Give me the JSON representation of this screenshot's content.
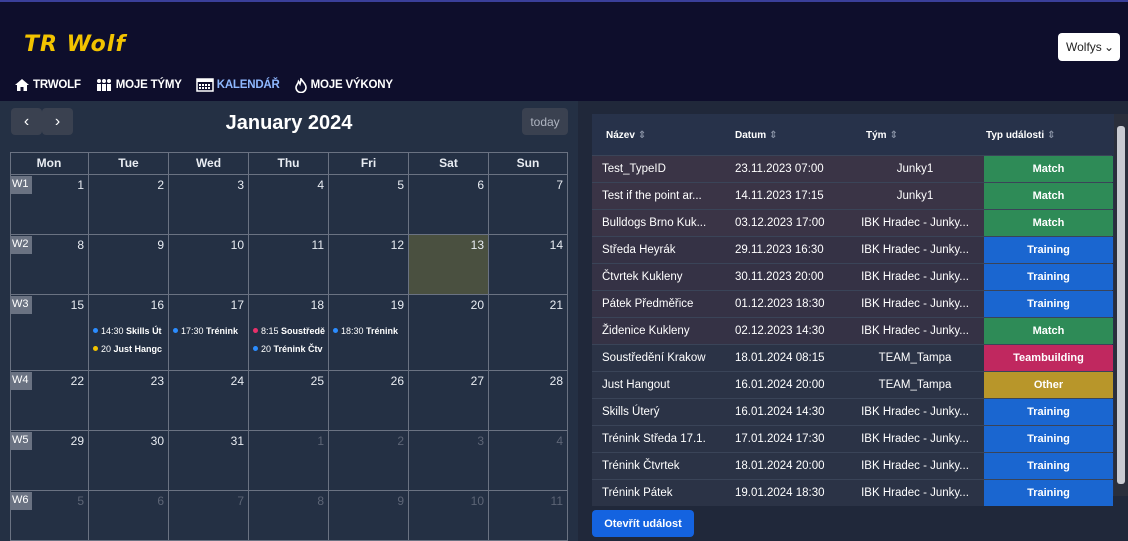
{
  "app": {
    "brand": "TR Wolf",
    "user": "Wolfys"
  },
  "nav": [
    {
      "label": "TRWOLF",
      "icon": "home-icon"
    },
    {
      "label": "MOJE TÝMY",
      "icon": "team-icon"
    },
    {
      "label": "KALENDÁŘ",
      "icon": "calendar-icon",
      "active": true
    },
    {
      "label": "MOJE VÝKONY",
      "icon": "fire-icon"
    }
  ],
  "calendar": {
    "title": "January 2024",
    "today_label": "today",
    "prev_label": "‹",
    "next_label": "›",
    "weekdays": [
      "Mon",
      "Tue",
      "Wed",
      "Thu",
      "Fri",
      "Sat",
      "Sun"
    ],
    "weeks": [
      {
        "label": "W1",
        "days": [
          "1",
          "2",
          "3",
          "4",
          "5",
          "6",
          "7"
        ]
      },
      {
        "label": "W2",
        "days": [
          "8",
          "9",
          "10",
          "11",
          "12",
          "13",
          "14"
        ]
      },
      {
        "label": "W3",
        "days": [
          "15",
          "16",
          "17",
          "18",
          "19",
          "20",
          "21"
        ]
      },
      {
        "label": "W4",
        "days": [
          "22",
          "23",
          "24",
          "25",
          "26",
          "27",
          "28"
        ]
      },
      {
        "label": "W5",
        "days": [
          "29",
          "30",
          "31",
          "1",
          "2",
          "3",
          "4"
        ]
      },
      {
        "label": "W6",
        "days": [
          "5",
          "6",
          "7",
          "8",
          "9",
          "10",
          "11"
        ]
      }
    ],
    "events": [
      {
        "time": "14:30",
        "title": "Skills Út",
        "color": "#2b8cff"
      },
      {
        "time": "20",
        "title": "Just Hangc",
        "color": "#f2c300"
      },
      {
        "time": "17:30",
        "title": "Trénink",
        "color": "#2b8cff"
      },
      {
        "time": "8:15",
        "title": "Soustředě",
        "color": "#e8306a"
      },
      {
        "time": "20",
        "title": "Trénink Čtv",
        "color": "#2b8cff"
      },
      {
        "time": "18:30",
        "title": "Trénink",
        "color": "#2b8cff"
      }
    ]
  },
  "events_table": {
    "headers": [
      "Název",
      "Datum",
      "Tým",
      "Typ události"
    ],
    "sort_glyph": "⇕",
    "rows": [
      {
        "name": "Test_TypeID",
        "date": "23.11.2023 07:00",
        "team": "Junky1",
        "type": "Match",
        "color": "#2e8b57"
      },
      {
        "name": "Test if the point ar...",
        "date": "14.11.2023 17:15",
        "team": "Junky1",
        "type": "Match",
        "color": "#2e8b57"
      },
      {
        "name": "Bulldogs Brno Kuk...",
        "date": "03.12.2023 17:00",
        "team": "IBK Hradec - Junky...",
        "type": "Match",
        "color": "#2e8b57"
      },
      {
        "name": "Středa Heyrák",
        "date": "29.11.2023 16:30",
        "team": "IBK Hradec - Junky...",
        "type": "Training",
        "color": "#1a66d0"
      },
      {
        "name": "Čtvrtek Kukleny",
        "date": "30.11.2023 20:00",
        "team": "IBK Hradec - Junky...",
        "type": "Training",
        "color": "#1a66d0"
      },
      {
        "name": "Pátek Předměřice",
        "date": "01.12.2023 18:30",
        "team": "IBK Hradec - Junky...",
        "type": "Training",
        "color": "#1a66d0"
      },
      {
        "name": "Židenice Kukleny",
        "date": "02.12.2023 14:30",
        "team": "IBK Hradec - Junky...",
        "type": "Match",
        "color": "#2e8b57"
      },
      {
        "name": "Soustředění Krakow",
        "date": "18.01.2024 08:15",
        "team": "TEAM_Tampa",
        "type": "Teambuilding",
        "color": "#c0285f"
      },
      {
        "name": "Just Hangout",
        "date": "16.01.2024 20:00",
        "team": "TEAM_Tampa",
        "type": "Other",
        "color": "#b8962a"
      },
      {
        "name": "Skills Úterý",
        "date": "16.01.2024 14:30",
        "team": "IBK Hradec - Junky...",
        "type": "Training",
        "color": "#1a66d0"
      },
      {
        "name": "Trénink Středa 17.1.",
        "date": "17.01.2024 17:30",
        "team": "IBK Hradec - Junky...",
        "type": "Training",
        "color": "#1a66d0"
      },
      {
        "name": "Trénink Čtvrtek",
        "date": "18.01.2024 20:00",
        "team": "IBK Hradec - Junky...",
        "type": "Training",
        "color": "#1a66d0"
      },
      {
        "name": "Trénink Pátek",
        "date": "19.01.2024 18:30",
        "team": "IBK Hradec - Junky...",
        "type": "Training",
        "color": "#1a66d0"
      }
    ],
    "open_button": "Otevřít událost"
  }
}
